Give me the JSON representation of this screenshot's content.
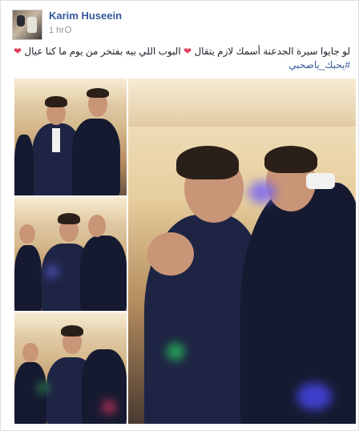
{
  "post": {
    "author": "Karim Huseein",
    "timestamp": "1 hr",
    "text_line1": "لو جايوا سيرة الجدعنة أسمك لازم يتقال",
    "text_line1b": "البوب اللي بيه بفتخر من يوم ما كنا عيال",
    "hashtag": "#يحبك_ياصحبي",
    "heart_icon": "heart-icon",
    "heart_color": "#e0405a",
    "link_color": "#365899"
  },
  "photos": [
    {
      "name": "wedding-photo-1"
    },
    {
      "name": "wedding-photo-2"
    },
    {
      "name": "wedding-photo-3"
    },
    {
      "name": "wedding-photo-main"
    }
  ]
}
